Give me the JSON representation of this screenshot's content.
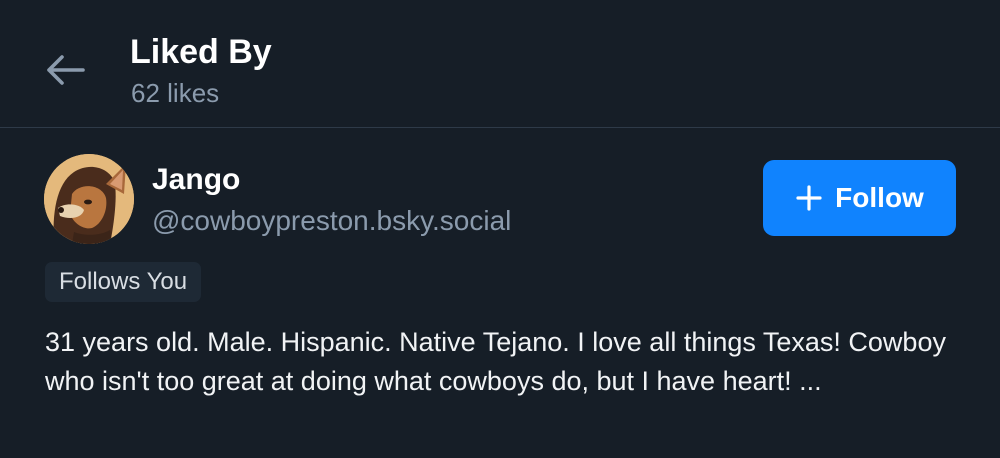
{
  "header": {
    "title": "Liked By",
    "subtitle": "62 likes",
    "back_icon": "arrow-left-icon"
  },
  "user": {
    "display_name": "Jango",
    "handle": "@cowboypreston.bsky.social",
    "follows_badge": "Follows You",
    "follow_button": {
      "icon": "plus-icon",
      "label": "Follow"
    },
    "bio": "31 years old. Male. Hispanic. Native Tejano. I love all things Texas! Cowboy who isn't too great at doing what cowboys do, but I have heart! ..."
  },
  "colors": {
    "background": "#161e27",
    "accent": "#1083fe",
    "muted_text": "#8b9bad",
    "badge_background": "#1e2935",
    "divider": "#2e3a48"
  }
}
